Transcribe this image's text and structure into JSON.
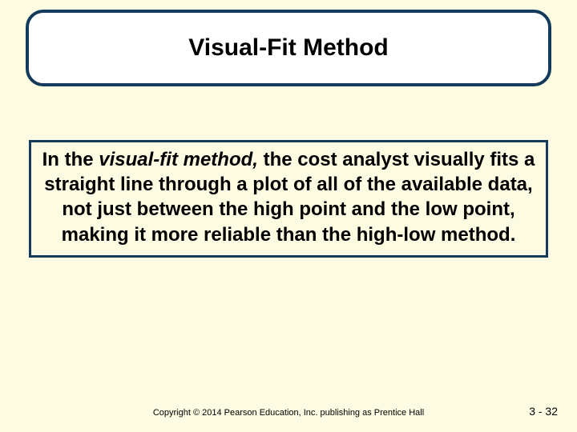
{
  "title": "Visual-Fit Method",
  "body": {
    "prefix": "In the ",
    "italic": "visual-fit method,",
    "rest": " the cost analyst visually fits a straight line through a plot of all of the available data, not just between the high point and the low point, making it more reliable than the high-low method."
  },
  "footer": {
    "copyright": "Copyright © 2014 Pearson Education, Inc. publishing as Prentice Hall",
    "page": "3 - 32"
  }
}
